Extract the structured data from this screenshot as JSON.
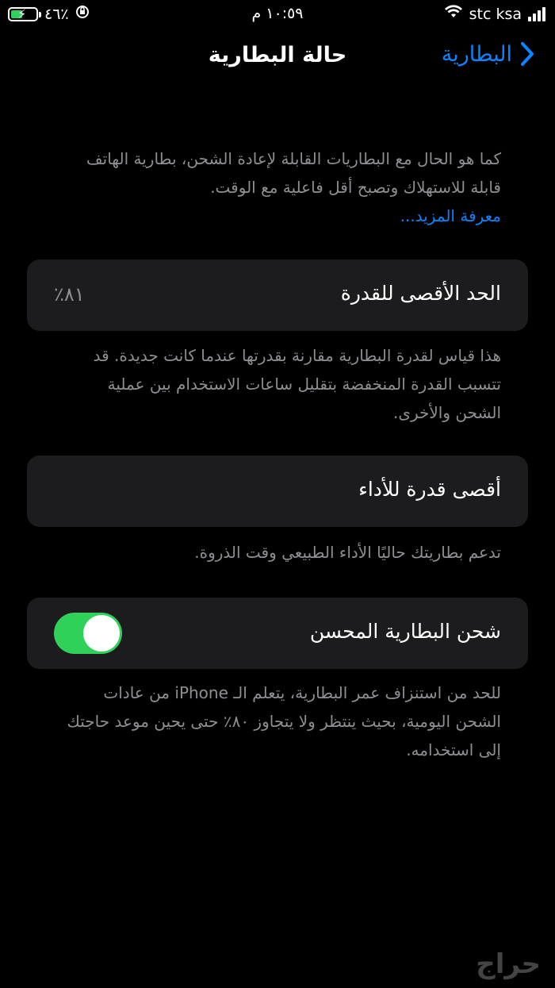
{
  "status_bar": {
    "carrier": "stc ksa",
    "time": "١٠:٥٩ م",
    "battery_percent": "٤٦٪",
    "battery_level": 0.46
  },
  "nav": {
    "title": "حالة البطارية",
    "back_label": "البطارية"
  },
  "intro": {
    "text": "كما هو الحال مع البطاريات القابلة لإعادة الشحن، بطارية الهاتف قابلة للاستهلاك وتصبح أقل فاعلية مع الوقت.",
    "link": "معرفة المزيد..."
  },
  "max_capacity": {
    "label": "الحد الأقصى للقدرة",
    "value": "٨١٪",
    "description": "هذا قياس لقدرة البطارية مقارنة بقدرتها عندما كانت جديدة. قد تتسبب القدرة المنخفضة بتقليل ساعات الاستخدام بين عملية الشحن والأخرى."
  },
  "peak_performance": {
    "label": "أقصى قدرة للأداء",
    "description": "تدعم بطاريتك حاليًا الأداء الطبيعي وقت الذروة."
  },
  "optimized_charging": {
    "label": "شحن البطارية المحسن",
    "enabled": true,
    "description": "للحد من استنزاف عمر البطارية، يتعلم الـ iPhone من عادات الشحن اليومية، بحيث ينتظر ولا يتجاوز ٨٠٪ حتى يحين موعد حاجتك إلى استخدامه."
  },
  "watermark": "حراج"
}
